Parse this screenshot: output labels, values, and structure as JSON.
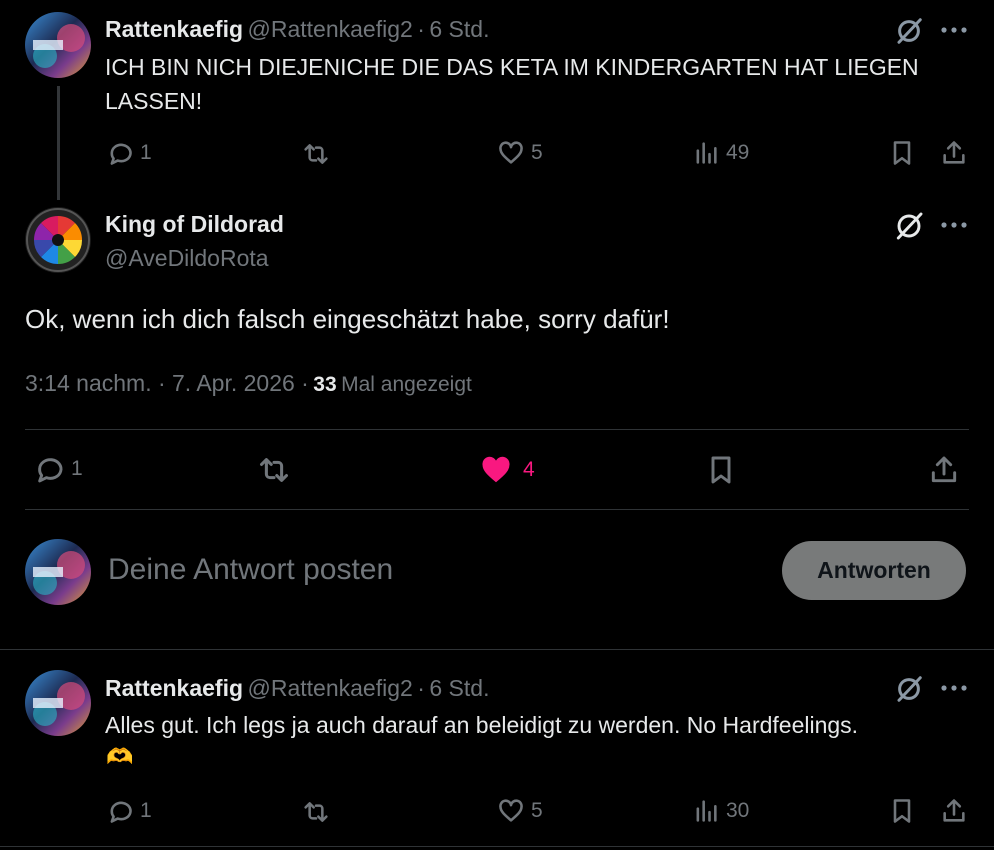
{
  "thread_tweet": {
    "author_name": "Rattenkaefig",
    "author_handle": "@Rattenkaefig2",
    "separator": "·",
    "time": "6 Std.",
    "text": "ICH BIN NICH DIEJENICHE DIE DAS KETA IM KINDERGARTEN HAT LIEGEN LASSEN!",
    "replies": "1",
    "likes": "5",
    "views": "49"
  },
  "main_tweet": {
    "author_name": "King of Dildorad",
    "author_handle": "@AveDildoRota",
    "text": "Ok, wenn ich dich falsch eingeschätzt habe, sorry dafür!",
    "timestamp": "3:14 nachm. · 7. Apr. 2026 ·",
    "views_count": "33",
    "views_label": "Mal angezeigt",
    "replies": "1",
    "likes": "4",
    "like_color": "#f91880"
  },
  "composer": {
    "placeholder": "Deine Antwort posten",
    "button_label": "Antworten"
  },
  "reply_tweet": {
    "author_name": "Rattenkaefig",
    "author_handle": "@Rattenkaefig2",
    "separator": "·",
    "time": "6 Std.",
    "text": "Alles gut. Ich legs ja auch darauf an beleidigt zu werden. No Hardfeelings.",
    "emoji": "🫶",
    "replies": "1",
    "likes": "5",
    "views": "30"
  },
  "icons": [
    "grok-icon",
    "more-icon",
    "reply-icon",
    "retweet-icon",
    "like-icon",
    "views-icon",
    "bookmark-icon",
    "share-icon"
  ]
}
